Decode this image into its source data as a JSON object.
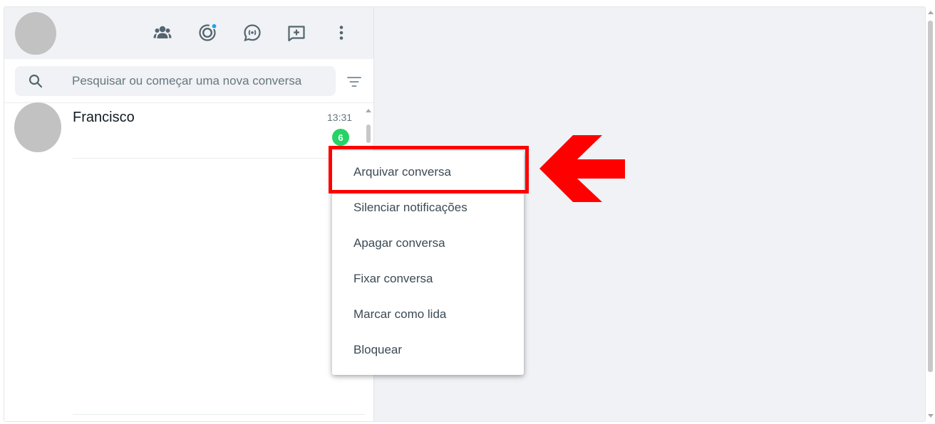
{
  "header": {
    "icons": [
      "communities-icon",
      "status-icon",
      "channels-icon",
      "new-chat-icon",
      "menu-icon"
    ],
    "status_dot_color": "#1ea7e1"
  },
  "search": {
    "placeholder": "Pesquisar ou começar uma nova conversa"
  },
  "chats": [
    {
      "name": "Francisco",
      "time": "13:31",
      "unread": "6"
    }
  ],
  "context_menu": {
    "items": [
      "Arquivar conversa",
      "Silenciar notificações",
      "Apagar conversa",
      "Fixar conversa",
      "Marcar como lida",
      "Bloquear"
    ]
  },
  "annotation": {
    "highlight_color": "#ff0000",
    "highlighted_item": "Arquivar conversa"
  },
  "colors": {
    "panel_bg": "#f0f2f5",
    "unread_badge": "#25d366",
    "icon": "#54656f"
  }
}
